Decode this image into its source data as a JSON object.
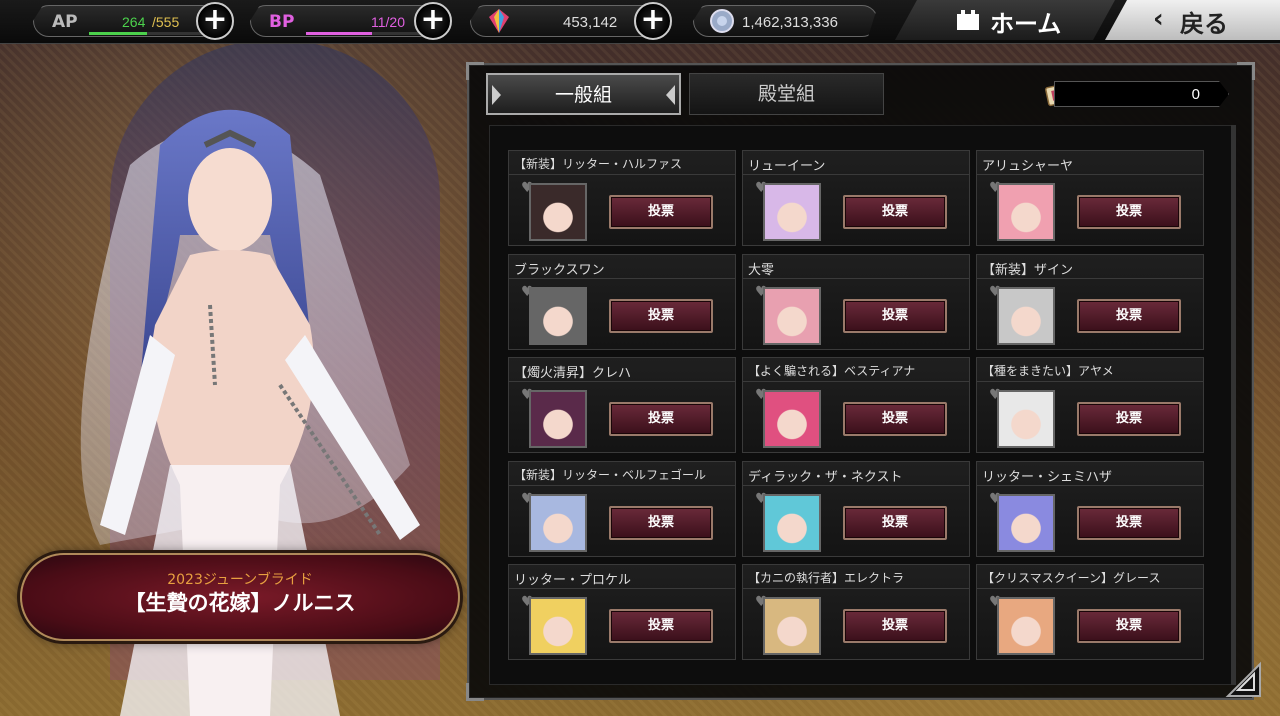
{
  "topbar": {
    "ap": {
      "label": "AP",
      "current": "264",
      "max": "/555",
      "fill_fraction": 0.48,
      "color": "#4cd14c"
    },
    "bp": {
      "label": "BP",
      "value": "11/20",
      "fill_fraction": 0.55,
      "color": "#e060e0"
    },
    "gems": {
      "value": "453,142",
      "icon": "rainbow-crystal-icon"
    },
    "coins": {
      "value": "1,462,313,336",
      "icon": "coin-icon"
    },
    "home_label": "ホーム",
    "back_label": "戻る"
  },
  "character": {
    "event": "2023ジューンブライド",
    "name": "【生贄の花嫁】ノルニス"
  },
  "panel": {
    "tabs": [
      "一般組",
      "殿堂組"
    ],
    "active_tab": 0,
    "ticket_count": "0",
    "vote_label": "投票",
    "cards": [
      {
        "title": "【新装】リッター・ハルファス",
        "small": true,
        "color": "#3a2a2a"
      },
      {
        "title": "リューイーン",
        "small": false,
        "color": "#d8b8e8"
      },
      {
        "title": "アリュシャーヤ",
        "small": false,
        "color": "#f0a0b0"
      },
      {
        "title": "ブラックスワン",
        "small": false,
        "color": "#666"
      },
      {
        "title": "大零",
        "small": false,
        "color": "#e8a0b0"
      },
      {
        "title": "【新装】ザイン",
        "small": false,
        "color": "#c8c8c8"
      },
      {
        "title": "【燭火清昇】クレハ",
        "small": false,
        "color": "#5a2a4a"
      },
      {
        "title": "【よく騙される】ベスティアナ",
        "small": true,
        "color": "#e05080"
      },
      {
        "title": "【種をまきたい】アヤメ",
        "small": true,
        "color": "#e8e8e8"
      },
      {
        "title": "【新装】リッター・ベルフェゴール",
        "small": true,
        "color": "#a8b8e0"
      },
      {
        "title": "ディラック・ザ・ネクスト",
        "small": false,
        "color": "#60c8d8"
      },
      {
        "title": "リッター・シェミハザ",
        "small": false,
        "color": "#8a8ae0"
      },
      {
        "title": "リッター・プロケル",
        "small": false,
        "color": "#f0d060"
      },
      {
        "title": "【カニの執行者】エレクトラ",
        "small": true,
        "color": "#d8b880"
      },
      {
        "title": "【クリスマスクイーン】グレース",
        "small": true,
        "color": "#e8a880"
      }
    ]
  }
}
